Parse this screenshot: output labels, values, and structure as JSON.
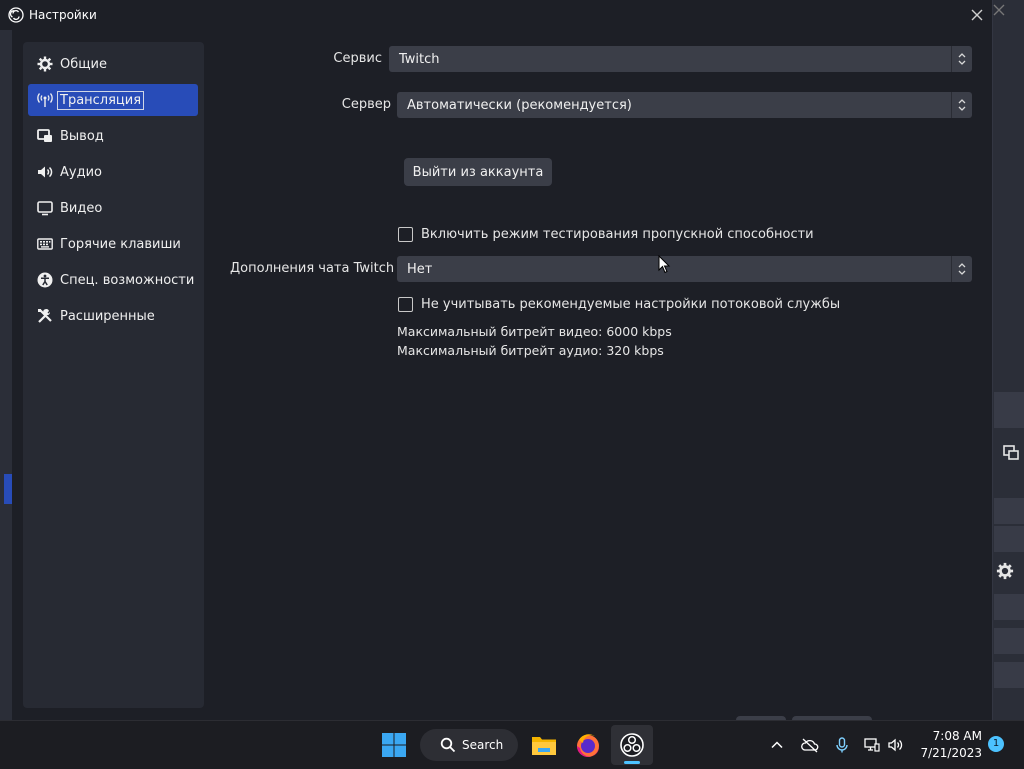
{
  "window": {
    "title": "Настройки"
  },
  "sidebar": {
    "items": [
      {
        "label": "Общие",
        "icon": "gear-icon",
        "active": false
      },
      {
        "label": "Трансляция",
        "icon": "broadcast-icon",
        "active": true
      },
      {
        "label": "Вывод",
        "icon": "output-icon",
        "active": false
      },
      {
        "label": "Аудио",
        "icon": "speaker-icon",
        "active": false
      },
      {
        "label": "Видео",
        "icon": "monitor-icon",
        "active": false
      },
      {
        "label": "Горячие клавиши",
        "icon": "keyboard-icon",
        "active": false
      },
      {
        "label": "Спец. возможности",
        "icon": "accessibility-icon",
        "active": false
      },
      {
        "label": "Расширенные",
        "icon": "tools-icon",
        "active": false
      }
    ]
  },
  "stream": {
    "service_label": "Сервис",
    "service_value": "Twitch",
    "server_label": "Сервер",
    "server_value": "Автоматически (рекомендуется)",
    "logout_button": "Выйти из аккаунта",
    "bandwidth_test_label": "Включить режим тестирования пропускной способности",
    "bandwidth_test_checked": false,
    "chat_addons_label": "Дополнения чата Twitch",
    "chat_addons_value": "Нет",
    "ignore_recommended_label": "Не учитывать рекомендуемые настройки потоковой службы",
    "ignore_recommended_checked": false,
    "max_video_bitrate": "Максимальный битрейт видео: 6000 kbps",
    "max_audio_bitrate": "Максимальный битрейт аудио: 320 kbps"
  },
  "taskbar": {
    "search_label": "Search",
    "time": "7:08 AM",
    "date": "7/21/2023",
    "notification_count": "1"
  },
  "colors": {
    "background": "#1d1f26",
    "sidebar": "#272a33",
    "accent": "#284cb8",
    "control": "#3b3e48",
    "taskbar_accent": "#4cc2ff"
  }
}
